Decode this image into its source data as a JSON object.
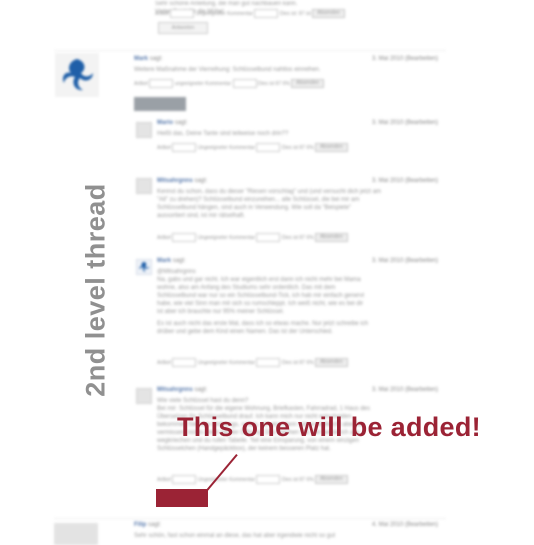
{
  "top_comment": {
    "body_lines": [
      "Sehr schöne Anleitung, die man gut nachbauen kann.",
      "Vielen Dank für die Mühe!"
    ],
    "rating": {
      "article_label": "Artikel",
      "article_value": "Toll",
      "comment_label": "Ungeeigneter Kommentar",
      "comment_value": "",
      "result": "Dies ist: 87 ist",
      "submit_label": "Absenden"
    },
    "reply_label": "Antworten"
  },
  "comment_main": {
    "author": "Mark",
    "says": "sagt:",
    "date": "3. Mai 2010 (Bearbeiten)",
    "body_lines": [
      "Weitere Maßnahme der Vierreihung: Schlüsselbund nahtlos einreihen."
    ],
    "rating": {
      "article_label": "Artikel",
      "article_value": "Toll",
      "comment_label": "ungeeigneter Kommentar",
      "comment_value": "",
      "result": "Dies ist 87 6%",
      "submit_label": "Absenden"
    }
  },
  "replies": [
    {
      "author": "Mario",
      "says": "sagt:",
      "date": "3. Mai 2010 (Bearbeiten)",
      "body_lines": [
        "Heißt das, Deine Tante sind teilweise noch drin??"
      ],
      "rating": {
        "article_label": "Artikel",
        "article_value": "Toll",
        "comment_label": "Ungeeigneter Kommentar",
        "comment_value": "",
        "result": "Dies ist 87 6%",
        "submit_label": "Absenden"
      }
    },
    {
      "author": "Mitsahrgnns",
      "says": "sagt:",
      "date": "3. Mai 2010 (Bearbeiten)",
      "body_lines": [
        "Kennst du schon, dass du dieser \"Riesen vorschlag\" und (und versucht dich jetzt am",
        "\"All\" zu drehen)? Schlüsselbund einzureihen... alle Schlüssel, die bei mir am",
        "Schlüsselbund hängen, sind auch in Verwendung. Wie soll da \"Beispiele\"",
        "aussortiert sind, ist mir rätselhaft."
      ],
      "rating": {
        "article_label": "Artikel",
        "article_value": "Toll",
        "comment_label": "Ungeeigneter Kommentar",
        "comment_value": "",
        "result": "Dies ist 87 6%",
        "submit_label": "Absenden"
      }
    },
    {
      "author": "Mark",
      "says": "sagt:",
      "date": "3. Mai 2010 (Bearbeiten)",
      "body_lines": [
        "@Mitsahrgnns",
        "Na, gabs und gar nicht. Ich war eigentlich erst dann ich nicht mehr bei Mama",
        "wohne, also am Anfang des Studiums sehr ordentlich. Das mit dem",
        "Schlüsselbund war nur so ein Schlüsselbund-Tick, ich hab mir einfach genervt",
        "habe, wie viel Sinn man mit sich so rumschleppt. Ich weiß nicht, wie es bei dir",
        "ist aber ich brauchte nur 95% meiner Schlüssel.",
        "",
        "Es ist auch nicht das erste Mal, dass ich so etwas mache. Nur jetzt schreibe ich",
        "drüber und gebe dem Kind einen Namen. Das ist der Unterschied."
      ],
      "rating": {
        "article_label": "Artikel",
        "article_value": "Toll",
        "comment_label": "Ungeeigneter Kommentar",
        "comment_value": "",
        "result": "Dies ist 87 6%",
        "submit_label": "Absenden"
      }
    },
    {
      "author": "Mitsahrgnns",
      "says": "sagt:",
      "date": "3. Mai 2010 (Bearbeiten)",
      "body_lines": [
        "Wie viele Schlüssel hast du denn?",
        "Bei mir: Schlüssel für die eigene Wohnung, Briefkasten, Fahrradrad, 1 Haus des",
        "Übersetzen für Schlüsselbund drauf. Ich kann mich nur nicht entscheiden",
        "bekommen Sie eine Ordnungs, schau, ob. also dann wär es vielleicht aber wo",
        "vermissen, nichts dreht mit der Öffnung. Das machen Sie, der werde ich alle",
        "wegkriechen und du rufen Tabelle. Teil eine Einsparung, von einem einzigen",
        "Schlüsselchen (Handgepäckbox), der keinem besseren Platz hat."
      ],
      "rating": {
        "article_label": "Artikel",
        "article_value": "Toll",
        "comment_label": "Ungeeigneter Kommentar",
        "comment_value": "",
        "result": "Dies ist 87 6%",
        "submit_label": "Absenden"
      }
    }
  ],
  "bottom_comment": {
    "author": "Filip",
    "says": "sagt:",
    "date": "4. Mai 2010 (Bearbeiten)",
    "body_lines": [
      "Sehr schön, fast schon einmal an diese, das hat aber irgendwie nicht so gut"
    ]
  },
  "annotations": {
    "side_label": "2nd level thread",
    "callout": "This one will be added!"
  },
  "colors": {
    "accent": "#9b2335",
    "link": "#5577aa",
    "muted": "#909090"
  }
}
